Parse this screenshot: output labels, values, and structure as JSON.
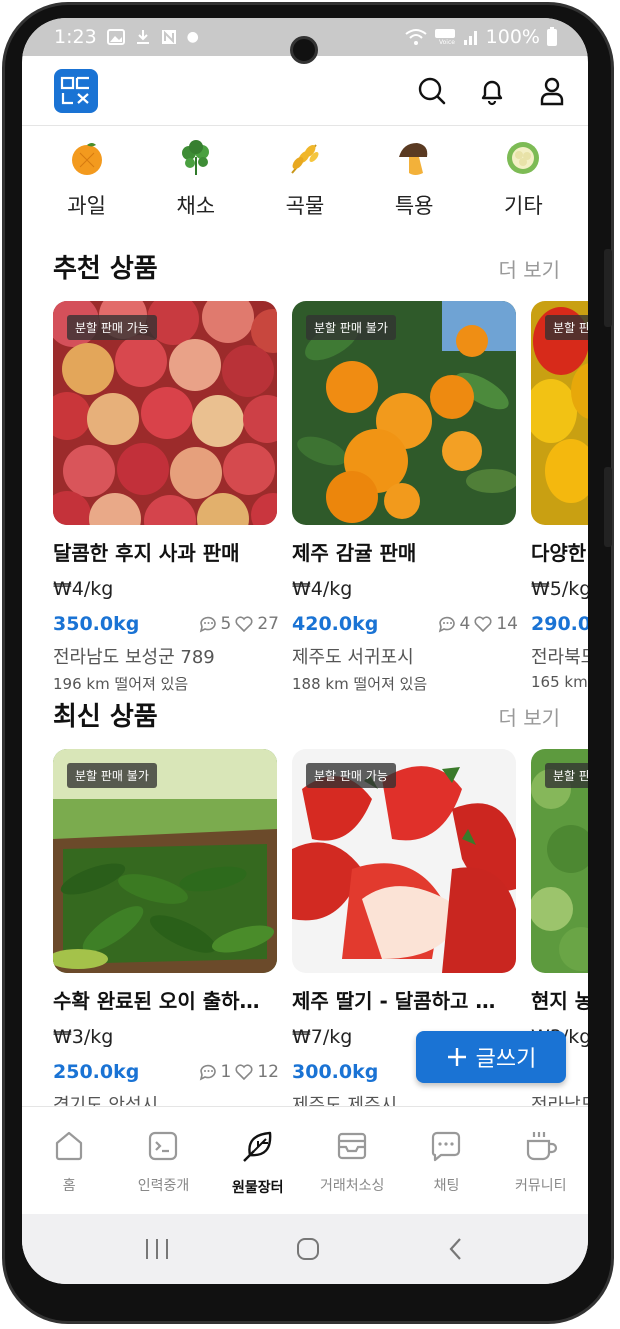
{
  "status": {
    "time": "1:23",
    "battery": "100%"
  },
  "logo_text": "ㅁㄷㄴㄷ",
  "categories": [
    {
      "label": "과일",
      "icon": "orange-icon"
    },
    {
      "label": "채소",
      "icon": "leaf-icon"
    },
    {
      "label": "곡물",
      "icon": "grain-icon"
    },
    {
      "label": "특용",
      "icon": "mushroom-icon"
    },
    {
      "label": "기타",
      "icon": "cauliflower-icon"
    }
  ],
  "recommended": {
    "title": "추천 상품",
    "more": "더 보기",
    "items": [
      {
        "badge": "분할 판매 가능",
        "title": "달콤한 후지 사과 판매",
        "price": "₩4/kg",
        "weight": "350.0kg",
        "comments": "5",
        "likes": "27",
        "location": "전라남도 보성군 789",
        "distance": "196 km 떨어져 있음"
      },
      {
        "badge": "분할 판매 불가",
        "title": "제주 감귤 판매",
        "price": "₩4/kg",
        "weight": "420.0kg",
        "comments": "4",
        "likes": "14",
        "location": "제주도 서귀포시",
        "distance": "188 km 떨어져 있음"
      },
      {
        "badge": "분할 판",
        "title": "다양한",
        "price": "₩5/kg",
        "weight": "290.0k",
        "location": "전라북도",
        "distance": "165 km"
      }
    ]
  },
  "latest": {
    "title": "최신 상품",
    "more": "더 보기",
    "items": [
      {
        "badge": "분할 판매 불가",
        "title": "수확 완료된 오이 출하…",
        "price": "₩3/kg",
        "weight": "250.0kg",
        "comments": "1",
        "likes": "12",
        "location": "경기도 안성시"
      },
      {
        "badge": "분할 판매 가능",
        "title": "제주 딸기 - 달콤하고 …",
        "price": "₩7/kg",
        "weight": "300.0kg",
        "location": "제주도 제주시"
      },
      {
        "badge": "분할 판",
        "title": "현지 농",
        "price": "₩3/kg",
        "weight": "0k",
        "location": "전라남도"
      }
    ]
  },
  "fab": {
    "label": "글쓰기"
  },
  "nav": [
    {
      "label": "홈",
      "icon": "home-icon"
    },
    {
      "label": "인력중개",
      "icon": "terminal-icon"
    },
    {
      "label": "원물장터",
      "icon": "leaf-outline-icon"
    },
    {
      "label": "거래처소싱",
      "icon": "inbox-icon"
    },
    {
      "label": "채팅",
      "icon": "chat-icon"
    },
    {
      "label": "커뮤니티",
      "icon": "coffee-icon"
    }
  ],
  "colors": {
    "accent": "#1a73d4",
    "price_blue": "#1a73d4"
  }
}
